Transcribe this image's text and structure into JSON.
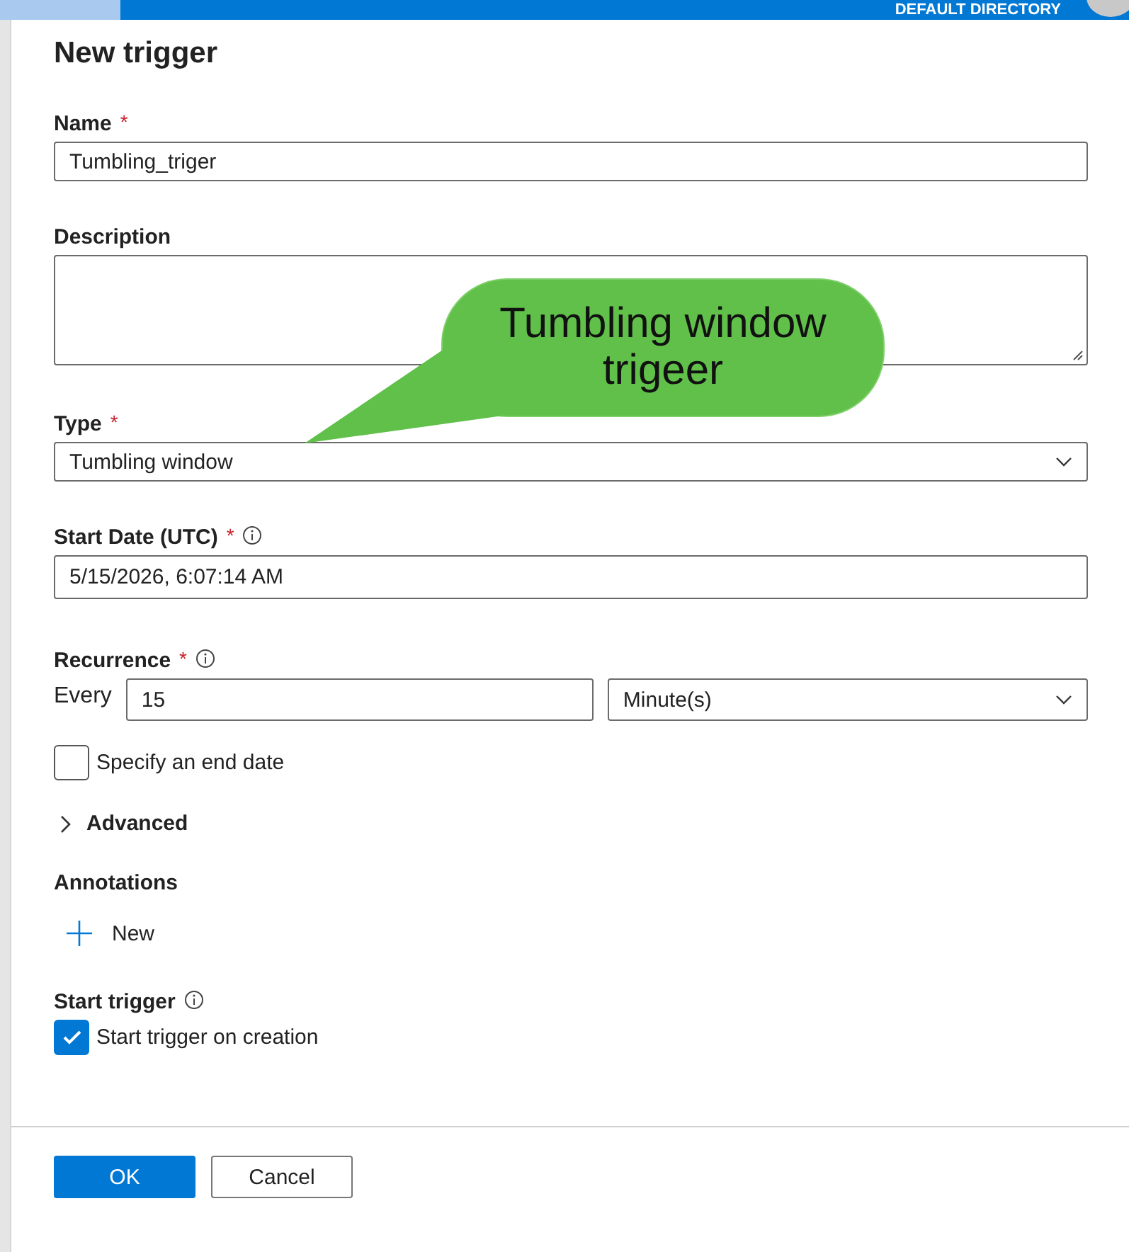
{
  "header": {
    "directory": "DEFAULT DIRECTORY"
  },
  "dialog": {
    "title": "New trigger",
    "name": {
      "label": "Name",
      "required_mark": "*",
      "value": "Tumbling_triger"
    },
    "description": {
      "label": "Description"
    },
    "type": {
      "label": "Type",
      "required_mark": "*",
      "value": "Tumbling window"
    },
    "start_date": {
      "label": "Start Date (UTC)",
      "required_mark": "*",
      "value": "5/15/2026, 6:07:14 AM"
    },
    "recurrence": {
      "label": "Recurrence",
      "required_mark": "*",
      "every_label": "Every",
      "interval": "15",
      "unit": "Minute(s)"
    },
    "end_date": {
      "label": "Specify an end date",
      "checked": false
    },
    "advanced": {
      "label": "Advanced",
      "expanded": false
    },
    "annotations": {
      "label": "Annotations",
      "new_label": "New"
    },
    "start_trigger": {
      "label": "Start trigger",
      "checkbox_label": "Start trigger on creation",
      "checked": true
    },
    "buttons": [
      {
        "label": "OK",
        "kind": "primary"
      },
      {
        "label": "Cancel",
        "kind": "secondary"
      }
    ]
  },
  "callout": {
    "text": "Tumbling window trigeer"
  }
}
